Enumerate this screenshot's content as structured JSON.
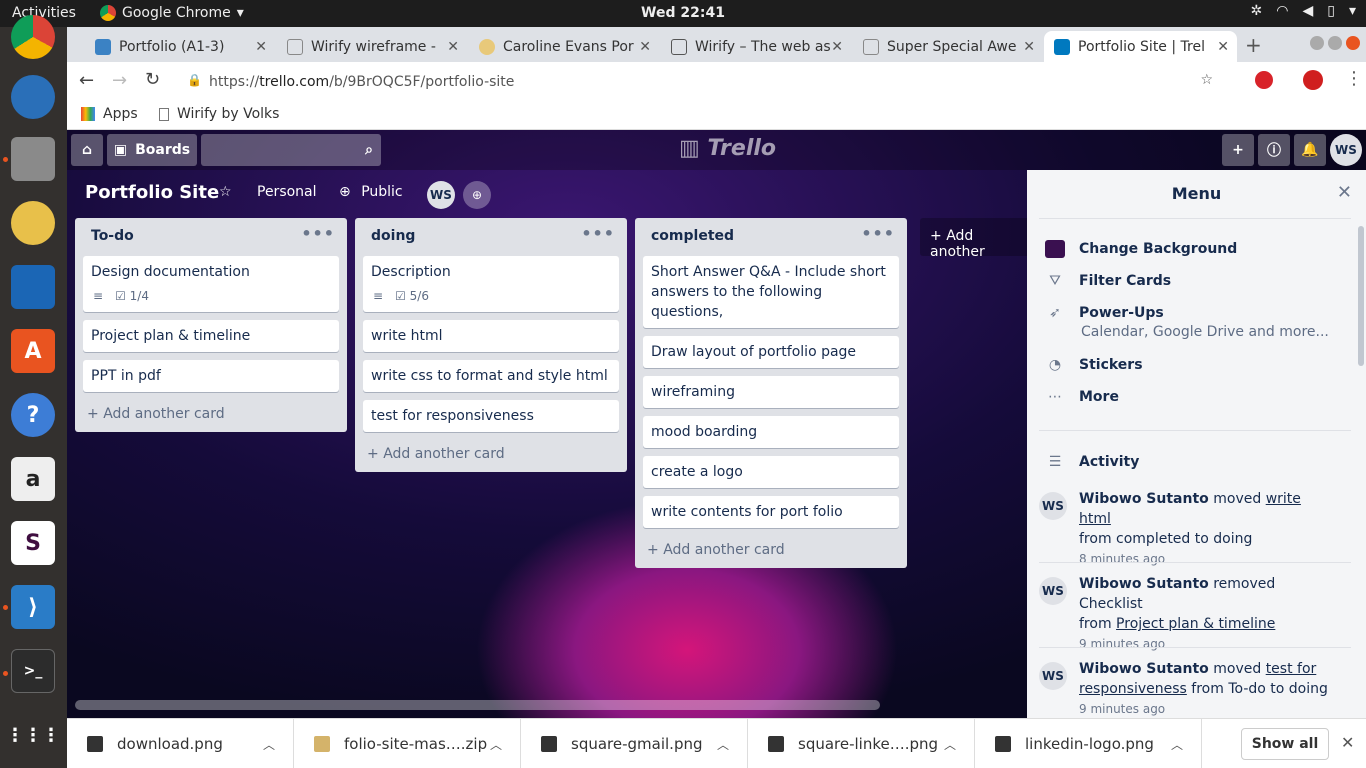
{
  "system": {
    "activities": "Activities",
    "app_name": "Google Chrome",
    "clock": "Wed 22:41"
  },
  "tabs": [
    {
      "title": "Portfolio (A1-3)"
    },
    {
      "title": "Wirify wireframe -"
    },
    {
      "title": "Caroline Evans Por"
    },
    {
      "title": "Wirify – The web as"
    },
    {
      "title": "Super Special Awe"
    },
    {
      "title": "Portfolio Site | Trel"
    }
  ],
  "address": {
    "url_prefix": "https://",
    "url_host": "trello.com",
    "url_path": "/b/9BrOQC5F/portfolio-site"
  },
  "bookmarks": {
    "apps": "Apps",
    "wirify": "Wirify by Volks"
  },
  "trello": {
    "header": {
      "boards": "Boards",
      "logo": "Trello",
      "avatar": "WS"
    },
    "board": {
      "name": "Portfolio Site",
      "team": "Personal",
      "visibility": "Public",
      "member_avatar": "WS"
    },
    "lists": [
      {
        "title": "To-do",
        "cards": [
          {
            "text": "Design documentation",
            "checklist": "1/4"
          },
          {
            "text": "Project plan & timeline"
          },
          {
            "text": "PPT in pdf"
          }
        ],
        "add": "Add another card"
      },
      {
        "title": "doing",
        "cards": [
          {
            "text": "Description",
            "checklist": "5/6"
          },
          {
            "text": "write html"
          },
          {
            "text": "write css to format and style html"
          },
          {
            "text": "test for responsiveness"
          }
        ],
        "add": "Add another card"
      },
      {
        "title": "completed",
        "cards": [
          {
            "text": "Short Answer Q&A - Include short answers to the following questions,"
          },
          {
            "text": "Draw layout of portfolio page"
          },
          {
            "text": "wireframing"
          },
          {
            "text": "mood boarding"
          },
          {
            "text": "create a logo"
          },
          {
            "text": "write contents for port folio"
          }
        ],
        "add": "Add another card"
      }
    ],
    "add_list": "Add another",
    "menu": {
      "title": "Menu",
      "items": {
        "background": "Change Background",
        "filter": "Filter Cards",
        "powerups": "Power-Ups",
        "powerups_sub": "Calendar, Google Drive and more...",
        "stickers": "Stickers",
        "more": "More"
      },
      "activity_title": "Activity",
      "activities": [
        {
          "user": "Wibowo Sutanto",
          "verb": "moved",
          "target": "write html",
          "rest": "from completed to doing",
          "time": "8 minutes ago",
          "avatar": "WS"
        },
        {
          "user": "Wibowo Sutanto",
          "verb": "removed Checklist",
          "rest_prefix": "from",
          "target": "Project plan & timeline",
          "time": "9 minutes ago",
          "avatar": "WS"
        },
        {
          "user": "Wibowo Sutanto",
          "verb": "moved",
          "target": "test for responsiveness",
          "rest": "from To-do to doing",
          "time": "9 minutes ago",
          "avatar": "WS"
        }
      ]
    }
  },
  "downloads": {
    "files": [
      "download.png",
      "folio-site-mas….zip",
      "square-gmail.png",
      "square-linke….png",
      "linkedin-logo.png"
    ],
    "show_all": "Show all"
  }
}
